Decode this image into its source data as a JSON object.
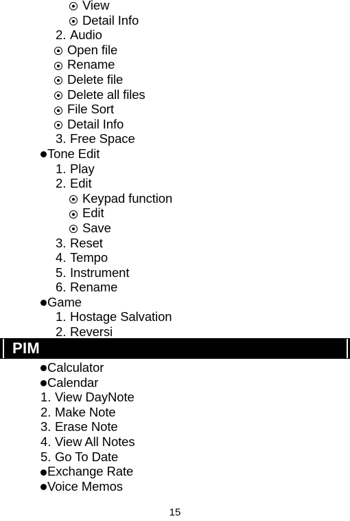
{
  "document": {
    "page_number": "15",
    "bullet_glyphs": {
      "filled": "filled-disc",
      "sub": "circled-dot"
    },
    "colors": {
      "text": "#000000",
      "section_bar_background": "#000000",
      "section_bar_text": "#ffffff",
      "page_background": "#ffffff"
    }
  },
  "upper_list": [
    {
      "marker": "sub",
      "indent": "sub-deep",
      "label": "View"
    },
    {
      "marker": "sub",
      "indent": "sub-deep",
      "label": "Detail Info"
    },
    {
      "marker": "number",
      "indent": "num-deep",
      "number": "2.",
      "label": "Audio"
    },
    {
      "marker": "sub",
      "indent": "sub",
      "label": "Open file"
    },
    {
      "marker": "sub",
      "indent": "sub",
      "label": "Rename"
    },
    {
      "marker": "sub",
      "indent": "sub",
      "label": "Delete file"
    },
    {
      "marker": "sub",
      "indent": "sub",
      "label": "Delete all files"
    },
    {
      "marker": "sub",
      "indent": "sub",
      "label": "File Sort"
    },
    {
      "marker": "sub",
      "indent": "sub",
      "label": "Detail Info"
    },
    {
      "marker": "number",
      "indent": "num-deep",
      "number": "3.",
      "label": "Free Space"
    },
    {
      "marker": "filled",
      "indent": "bullet",
      "label": "Tone Edit"
    },
    {
      "marker": "number",
      "indent": "num-deep",
      "number": "1.",
      "label": "Play"
    },
    {
      "marker": "number",
      "indent": "num-deep",
      "number": "2.",
      "label": "Edit"
    },
    {
      "marker": "sub",
      "indent": "sub-deep",
      "label": "Keypad function"
    },
    {
      "marker": "sub",
      "indent": "sub-deep",
      "label": "Edit"
    },
    {
      "marker": "sub",
      "indent": "sub-deep",
      "label": "Save"
    },
    {
      "marker": "number",
      "indent": "num-deep",
      "number": "3.",
      "label": "Reset"
    },
    {
      "marker": "number",
      "indent": "num-deep",
      "number": "4.",
      "label": "Tempo"
    },
    {
      "marker": "number",
      "indent": "num-deep",
      "number": "5.",
      "label": "Instrument"
    },
    {
      "marker": "number",
      "indent": "num-deep",
      "number": "6.",
      "label": "Rename"
    },
    {
      "marker": "filled",
      "indent": "bullet",
      "label": "Game"
    },
    {
      "marker": "number",
      "indent": "num-deep",
      "number": "1.",
      "label": "Hostage Salvation"
    },
    {
      "marker": "number",
      "indent": "num-deep",
      "number": "2.",
      "label": "Reversi"
    }
  ],
  "section": {
    "title": "PIM"
  },
  "lower_list": [
    {
      "marker": "filled",
      "indent": "bullet",
      "label": "Calculator"
    },
    {
      "marker": "filled",
      "indent": "bullet",
      "label": "Calendar"
    },
    {
      "marker": "number",
      "indent": "num-flat",
      "number": "1.",
      "label": "View DayNote"
    },
    {
      "marker": "number",
      "indent": "num-flat",
      "number": "2.",
      "label": "Make Note"
    },
    {
      "marker": "number",
      "indent": "num-flat",
      "number": "3.",
      "label": "Erase Note"
    },
    {
      "marker": "number",
      "indent": "num-flat",
      "number": "4.",
      "label": "View All Notes"
    },
    {
      "marker": "number",
      "indent": "num-flat",
      "number": "5.",
      "label": "Go To Date"
    },
    {
      "marker": "filled",
      "indent": "bullet",
      "label": "Exchange Rate"
    },
    {
      "marker": "filled",
      "indent": "bullet",
      "label": "Voice Memos"
    }
  ]
}
